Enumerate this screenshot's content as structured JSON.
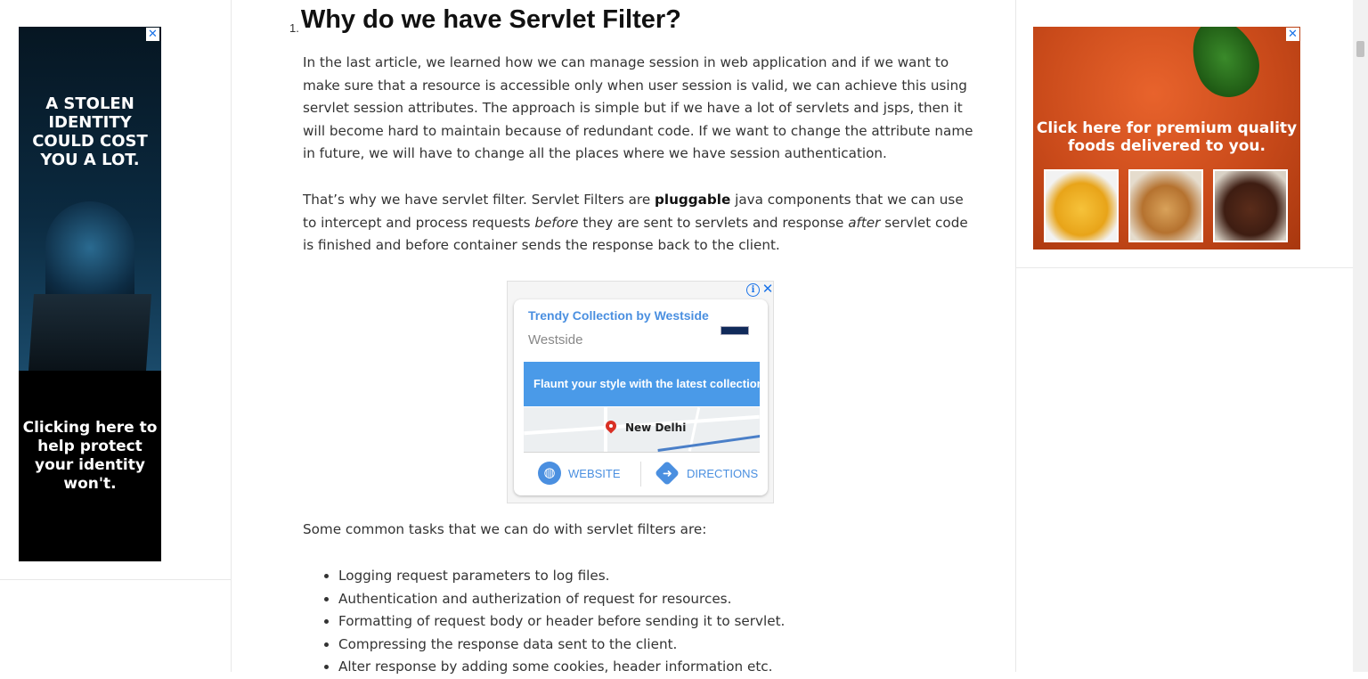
{
  "article": {
    "heading_number": "1.",
    "heading": "Why do we have Servlet Filter?",
    "p1": "In the last article, we learned how we can manage session in web application and if we want to make sure that a resource is accessible only when user session is valid, we can achieve this using servlet session attributes. The approach is simple but if we have a lot of servlets and jsps, then it will become hard to maintain because of redundant code. If we want to change the attribute name in future, we will have to change all the places where we have session authentication.",
    "p2_a": "That’s why we have servlet filter. Servlet Filters are ",
    "p2_b": "pluggable",
    "p2_c": " java components that we can use to intercept and process requests ",
    "p2_d": "before",
    "p2_e": " they are sent to servlets and response ",
    "p2_f": "after",
    "p2_g": " servlet code is finished and before container sends the response back to the client.",
    "p3": "Some common tasks that we can do with servlet filters are:",
    "list": [
      "Logging request parameters to log files.",
      "Authentication and autherization of request for resources.",
      "Formatting of request body or header before sending it to servlet.",
      "Compressing the response data sent to the client.",
      "Alter response by adding some cookies, header information etc."
    ]
  },
  "left_ad": {
    "headline": "A STOLEN IDENTITY COULD COST YOU A LOT.",
    "bottom_text": "Clicking here to help protect your identity won't.",
    "close": "✕"
  },
  "right_ad": {
    "headline": "Click here for premium quality foods delivered to you.",
    "close": "✕"
  },
  "inline_ad": {
    "info": "i",
    "close": "✕",
    "title": "Trendy Collection by Westside",
    "brand": "Westside",
    "banner": "Flaunt your style with the latest collection",
    "city": "New Delhi",
    "website_label": "WEBSITE",
    "directions_label": "DIRECTIONS"
  },
  "colors": {
    "link_blue": "#4a8fe0",
    "ad_blue": "#1a73e8"
  }
}
